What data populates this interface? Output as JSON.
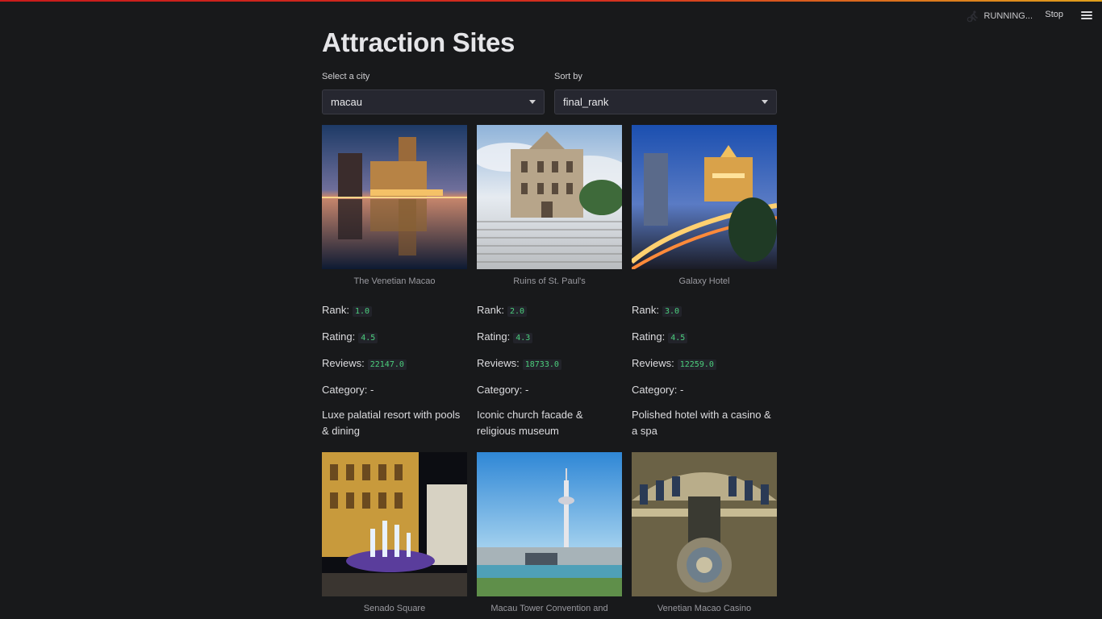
{
  "header": {
    "status_text": "RUNNING...",
    "stop_label": "Stop",
    "menu_icon": "hamburger-menu-icon",
    "running_icon": "running-figure-icon"
  },
  "page": {
    "title": "Attraction Sites"
  },
  "filters": {
    "city": {
      "label": "Select a city",
      "value": "macau"
    },
    "sort": {
      "label": "Sort by",
      "value": "final_rank"
    }
  },
  "labels": {
    "rank": "Rank:",
    "rating": "Rating:",
    "reviews": "Reviews:"
  },
  "attractions": [
    {
      "name": "The Venetian Macao",
      "rank": "1.0",
      "rating": "4.5",
      "reviews": "22147.0",
      "category": "Category: -",
      "description": "Luxe palatial resort with pools & dining"
    },
    {
      "name": "Ruins of St. Paul's",
      "rank": "2.0",
      "rating": "4.3",
      "reviews": "18733.0",
      "category": "Category: -",
      "description": "Iconic church facade & religious museum"
    },
    {
      "name": "Galaxy Hotel",
      "rank": "3.0",
      "rating": "4.5",
      "reviews": "12259.0",
      "category": "Category: -",
      "description": "Polished hotel with a casino & a spa"
    },
    {
      "name": "Senado Square"
    },
    {
      "name": "Macau Tower Convention and"
    },
    {
      "name": "Venetian Macao Casino"
    }
  ],
  "colors": {
    "background": "#18191b",
    "accent_code": "#4ccf7d",
    "top_bar": "#c91b1b"
  }
}
